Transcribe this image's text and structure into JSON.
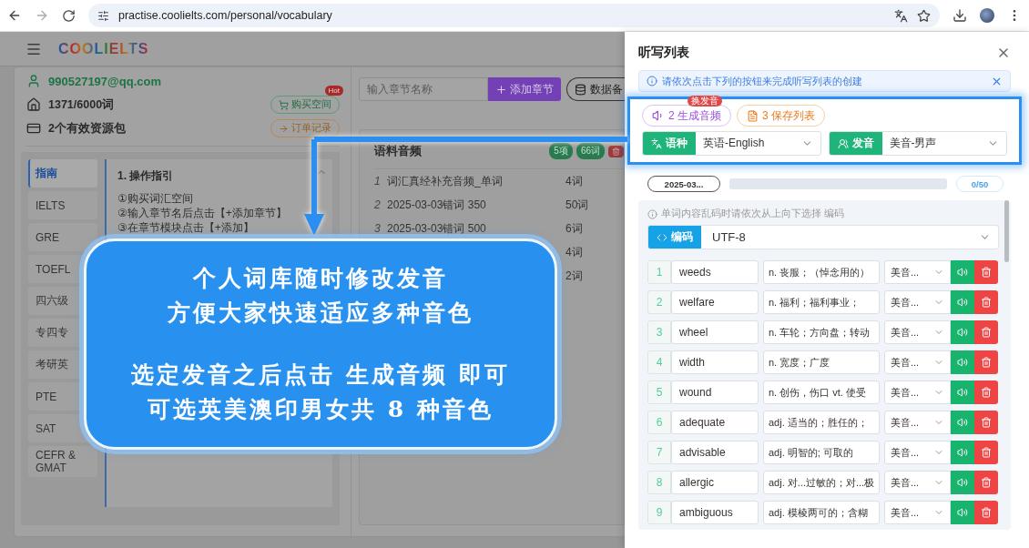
{
  "browser": {
    "url": "practise.coolielts.com/personal/vocabulary"
  },
  "app": {
    "logo": "COOLIELTS",
    "user": {
      "email": "990527197@qq.com",
      "words": "1371/6000词",
      "packages": "2个有效资源包"
    },
    "actions": [
      {
        "label": "购买空间",
        "kind": "buy",
        "badge": "Hot"
      },
      {
        "label": "订单记录",
        "kind": "orders"
      }
    ],
    "sidebar": [
      {
        "label": "指南",
        "selected": true
      },
      {
        "label": "IELTS",
        "selected": false
      },
      {
        "label": "GRE",
        "selected": false
      },
      {
        "label": "TOEFL",
        "selected": false
      },
      {
        "label": "四六级",
        "selected": false
      },
      {
        "label": "专四专",
        "selected": false
      },
      {
        "label": "考研英",
        "selected": false
      },
      {
        "label": "PTE",
        "selected": false
      },
      {
        "label": "SAT",
        "selected": false
      },
      {
        "label": "CEFR & GMAT",
        "selected": false
      }
    ],
    "guide": {
      "title": "1. 操作指引",
      "steps": [
        "①购买词汇空间",
        "②输入章节名后点击【+添加章节】",
        "③在章节模块点击【+添加】"
      ]
    },
    "chapter": {
      "placeholder": "输入章节名称",
      "add": "添加章节",
      "backup": "数据备"
    },
    "corpus": {
      "title": "语料音频",
      "badges": [
        "5项",
        "66词"
      ],
      "rows": [
        {
          "index": "1",
          "name": "词汇真经补充音频_单词",
          "count": "4词"
        },
        {
          "index": "2",
          "name": "2025-03-03错词 350",
          "count": "50词"
        },
        {
          "index": "3",
          "name": "2025-03-03错词 500",
          "count": "6词"
        },
        {
          "count": "4词"
        },
        {
          "count": "2词"
        }
      ]
    }
  },
  "drawer": {
    "title": "听写列表",
    "alert": "请依次点击下列的按钮来完成听写列表的创建",
    "steps": [
      {
        "kind": "audio",
        "label": "2 生成音频",
        "badge": "换发音"
      },
      {
        "kind": "save",
        "label": "3 保存列表"
      }
    ],
    "selects": [
      {
        "kind": "language",
        "label": "语种",
        "value": "英语-English"
      },
      {
        "kind": "voice",
        "label": "发音",
        "value": "美音-男声"
      }
    ],
    "progress": {
      "name": "2025-03...",
      "level": 0,
      "count": "0/50"
    },
    "hint": "单词内容乱码时请依次从上向下选择 编码",
    "encoding": {
      "label": "编码",
      "value": "UTF-8"
    },
    "words": [
      {
        "index": "1",
        "word": "weeds",
        "definition": "n. 丧服；（悼念用的）",
        "voice": "美音..."
      },
      {
        "index": "2",
        "word": "welfare",
        "definition": "n. 福利；福利事业；",
        "voice": "美音..."
      },
      {
        "index": "3",
        "word": "wheel",
        "definition": "n. 车轮；方向盘；转动",
        "voice": "美音..."
      },
      {
        "index": "4",
        "word": "width",
        "definition": "n. 宽度；广度",
        "voice": "美音..."
      },
      {
        "index": "5",
        "word": "wound",
        "definition": "n. 创伤，伤口 vt. 使受",
        "voice": "美音..."
      },
      {
        "index": "6",
        "word": "adequate",
        "definition": "adj. 适当的；胜任的；",
        "voice": "美音..."
      },
      {
        "index": "7",
        "word": "advisable",
        "definition": "adj. 明智的; 可取的",
        "voice": "美音..."
      },
      {
        "index": "8",
        "word": "allergic",
        "definition": "adj. 对...过敏的；对...极",
        "voice": "美音..."
      },
      {
        "index": "9",
        "word": "ambiguous",
        "definition": "adj. 模棱两可的；含糊",
        "voice": "美音..."
      }
    ]
  },
  "callout": {
    "paragraphs": [
      [
        "个人词库随时修改发音",
        "方便大家快速适应多种音色"
      ],
      [
        "选定发音之后点击 生成音频 即可",
        "可选英美澳印男女共 8 种音色"
      ]
    ]
  }
}
